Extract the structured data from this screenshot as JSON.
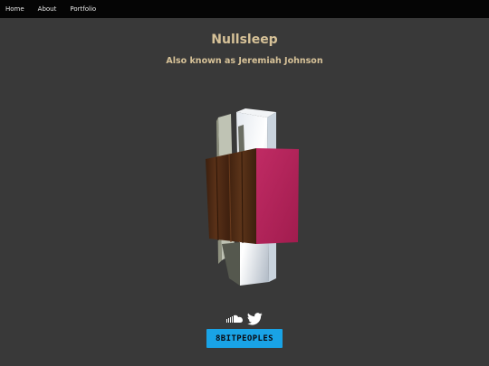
{
  "nav": {
    "items": [
      {
        "label": "Home"
      },
      {
        "label": "About"
      },
      {
        "label": "Portfolio"
      }
    ]
  },
  "profile": {
    "name": "Nullsleep",
    "aka": "Also known as Jeremiah Johnson"
  },
  "social": {
    "icons": [
      "soundcloud-icon",
      "twitter-icon"
    ]
  },
  "badge": {
    "label": "8BITPEOPLES",
    "color": "#19a3e6"
  },
  "colors": {
    "background": "#393939",
    "nav_background": "#050505",
    "heading": "#d7c298",
    "block_magenta": "#b02357",
    "block_wood": "#4c2a13"
  }
}
